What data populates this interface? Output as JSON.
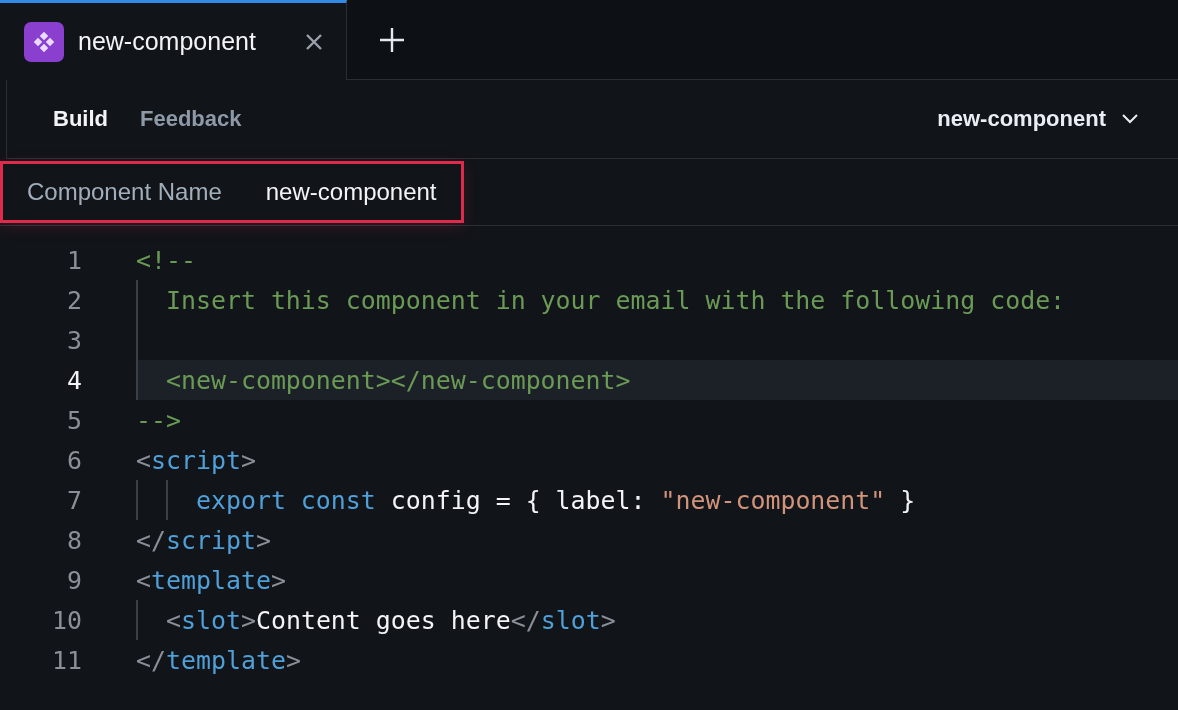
{
  "tabs": [
    {
      "label": "new-component",
      "selected": true
    }
  ],
  "toolbar": {
    "tabs": [
      {
        "label": "Build",
        "selected": true
      },
      {
        "label": "Feedback",
        "selected": false
      }
    ],
    "component_select": "new-component"
  },
  "component_name": {
    "label": "Component Name",
    "value": "new-component",
    "highlighted": true
  },
  "editor": {
    "lines": [
      {
        "number": "1",
        "active": false,
        "tokens": [
          {
            "kind": "comment",
            "text": "<!--"
          }
        ]
      },
      {
        "number": "2",
        "active": false,
        "tokens": [
          {
            "kind": "comment",
            "text": "  Insert this component in your email with the following code:"
          }
        ]
      },
      {
        "number": "3",
        "active": false
      },
      {
        "number": "4",
        "active": true,
        "tokens": [
          {
            "kind": "comment",
            "text": "  <new-component></new-component>"
          }
        ]
      },
      {
        "number": "5",
        "active": false,
        "tokens": [
          {
            "kind": "comment",
            "text": "-->"
          }
        ]
      },
      {
        "number": "6",
        "active": false,
        "tokens": [
          {
            "kind": "punct",
            "text": "<"
          },
          {
            "kind": "tag",
            "text": "script"
          },
          {
            "kind": "punct",
            "text": ">"
          }
        ]
      },
      {
        "number": "7",
        "active": false,
        "tokens": [
          {
            "kind": "keyword",
            "text": "    export const"
          },
          {
            "kind": "text",
            "text": " config = { label: "
          },
          {
            "kind": "string",
            "text": "\"new-component\""
          },
          {
            "kind": "text",
            "text": " }"
          }
        ]
      },
      {
        "number": "8",
        "active": false,
        "tokens": [
          {
            "kind": "punct",
            "text": "</"
          },
          {
            "kind": "tag",
            "text": "script"
          },
          {
            "kind": "punct",
            "text": ">"
          }
        ]
      },
      {
        "number": "9",
        "active": false,
        "tokens": [
          {
            "kind": "punct",
            "text": "<"
          },
          {
            "kind": "tag",
            "text": "template"
          },
          {
            "kind": "punct",
            "text": ">"
          }
        ]
      },
      {
        "number": "10",
        "active": false,
        "tokens": [
          {
            "kind": "punct",
            "text": "  <"
          },
          {
            "kind": "tag",
            "text": "slot"
          },
          {
            "kind": "punct",
            "text": ">"
          },
          {
            "kind": "text",
            "text": "Content goes here"
          },
          {
            "kind": "punct",
            "text": "</"
          },
          {
            "kind": "tag",
            "text": "slot"
          },
          {
            "kind": "punct",
            "text": ">"
          }
        ]
      },
      {
        "number": "11",
        "active": false,
        "tokens": [
          {
            "kind": "punct",
            "text": "</"
          },
          {
            "kind": "tag",
            "text": "template"
          },
          {
            "kind": "punct",
            "text": ">"
          }
        ]
      }
    ]
  }
}
